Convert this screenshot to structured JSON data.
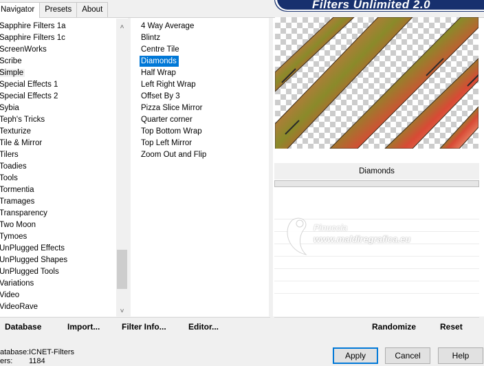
{
  "tabs": [
    "Navigator",
    "Presets",
    "About"
  ],
  "banner_title": "Filters Unlimited 2.0",
  "categories": [
    "Sapphire Filters 1a",
    "Sapphire Filters 1c",
    "ScreenWorks",
    "Scribe",
    "Simple",
    "Special Effects 1",
    "Special Effects 2",
    "Sybia",
    "Teph's Tricks",
    "Texturize",
    "Tile & Mirror",
    "Tilers",
    "Toadies",
    "Tools",
    "Tormentia",
    "Tramages",
    "Transparency",
    "Two Moon",
    "Tymoes",
    "UnPlugged Effects",
    "UnPlugged Shapes",
    "UnPlugged Tools",
    "Variations",
    "Video",
    "VideoRave"
  ],
  "selected_category": "Simple",
  "filters": [
    "4 Way Average",
    "Blintz",
    "Centre Tile",
    "Diamonds",
    "Half Wrap",
    "Left Right Wrap",
    "Offset By 3",
    "Pizza Slice Mirror",
    "Quarter corner",
    "Top Bottom Wrap",
    "Top Left Mirror",
    "Zoom Out and Flip"
  ],
  "selected_filter": "Diamonds",
  "preview_filter_name": "Diamonds",
  "watermark": {
    "line1": "Pinuccia",
    "line2": "www.maldiregrafica.eu"
  },
  "left_toolbar": {
    "database": "Database",
    "import": "Import...",
    "filter_info": "Filter Info...",
    "editor": "Editor..."
  },
  "right_toolbar": {
    "randomize": "Randomize",
    "reset": "Reset"
  },
  "footer": {
    "database_label": "atabase:",
    "database_value": "ICNET-Filters",
    "filters_label": "ers:",
    "filters_value": "1184"
  },
  "buttons": {
    "apply": "Apply",
    "cancel": "Cancel",
    "help": "Help"
  },
  "icons": {
    "scroll_up": "chevron-up-icon",
    "scroll_down": "chevron-down-icon"
  },
  "colors": {
    "selection": "#0078d7",
    "banner": "#17306e"
  }
}
